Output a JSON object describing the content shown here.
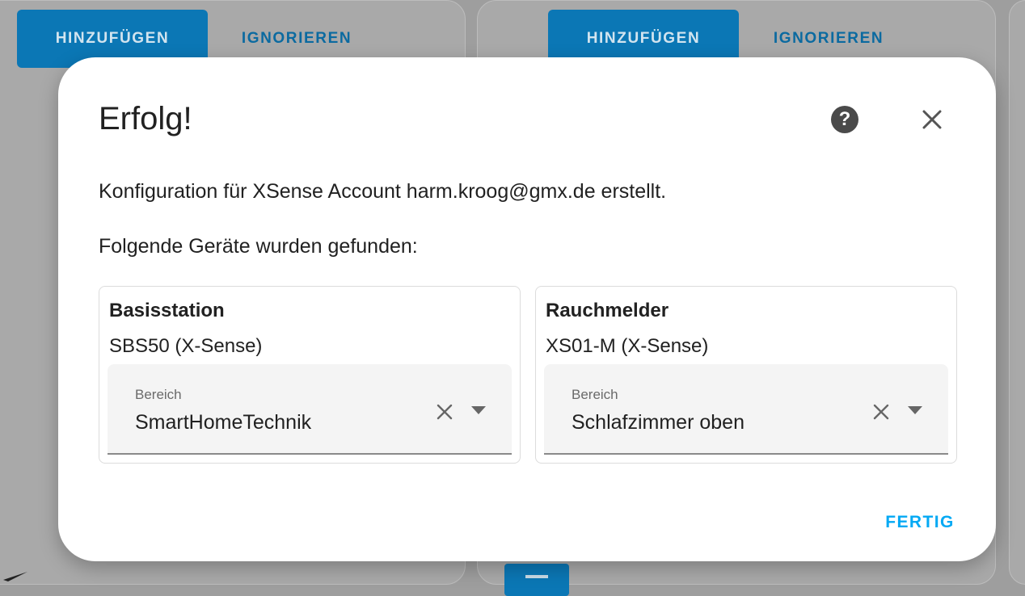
{
  "background": {
    "left_card": {
      "add_label": "HINZUFÜGEN",
      "ignore_label": "IGNORIEREN"
    },
    "right_card": {
      "add_label": "HINZUFÜGEN",
      "ignore_label": "IGNORIEREN"
    }
  },
  "dialog": {
    "title": "Erfolg!",
    "help_icon": "question-mark-icon",
    "close_icon": "close-icon",
    "message": "Konfiguration für XSense Account harm.kroog@gmx.de erstellt.",
    "devices_heading": "Folgende Geräte wurden gefunden:",
    "devices": [
      {
        "name": "Basisstation",
        "model": "SBS50 (X-Sense)",
        "area_label": "Bereich",
        "area_value": "SmartHomeTechnik"
      },
      {
        "name": "Rauchmelder",
        "model": "XS01-M (X-Sense)",
        "area_label": "Bereich",
        "area_value": "Schlafzimmer oben"
      }
    ],
    "done_label": "FERTIG"
  },
  "colors": {
    "primary": "#03a9f4",
    "button_bg": "#0b77b5",
    "overlay": "#9e9e9e"
  }
}
